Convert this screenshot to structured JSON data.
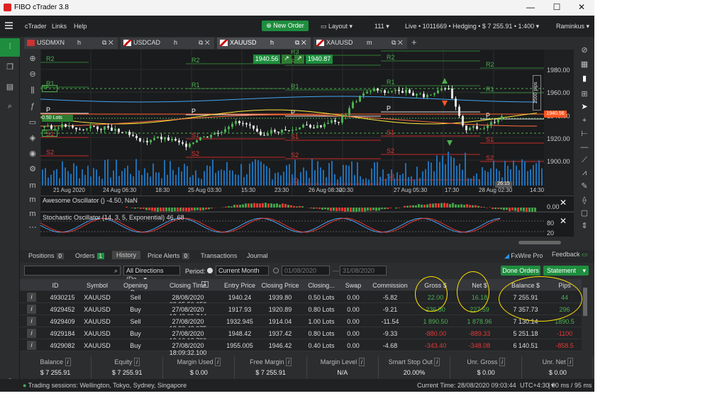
{
  "app": {
    "title": "FIBO cTrader 3.8",
    "icon": "ctrader-logo-icon"
  },
  "menu": {
    "items": [
      "cTrader",
      "Links",
      "Help"
    ],
    "new_order": "New Order",
    "layout": "Layout",
    "count": "111",
    "account": "Live • 1011669 • Hedging • $ 7 255.91 • 1:400",
    "user": "Raminkus"
  },
  "tabs": [
    {
      "symbol": "USDMXN",
      "tf": "h"
    },
    {
      "symbol": "USDCAD",
      "tf": "h"
    },
    {
      "symbol": "XAUUSD",
      "tf": "h"
    },
    {
      "symbol": "XAUUSD",
      "tf": "m"
    }
  ],
  "chart": {
    "sell_price": "1940.56",
    "buy_price": "1940.87",
    "pips_label": "2500 pips",
    "current_price": "1940.56",
    "y_ticks": [
      "1980.00",
      "1960.00",
      "1940.00",
      "1920.00",
      "1900.00"
    ],
    "x_ticks": [
      "21 Aug 2020",
      "24 Aug 06:30",
      "18:30",
      "25 Aug 03:30",
      "15:30",
      "23:30",
      "26 Aug 08:30",
      "20:30",
      "27 Aug 05:30",
      "17:30",
      "28 Aug 02:30",
      "14:30"
    ],
    "time_badge": "26:15",
    "levels": [
      "R3",
      "R2",
      "R1",
      "P",
      "S1",
      "S2",
      "S3"
    ],
    "tp_label": "TP",
    "lots_label": "0.50 Lots",
    "sl_label": "SL"
  },
  "oscillators": {
    "ao": "Awesome Oscillator () -4.50, NaN",
    "ao_tick": "0.00",
    "stoch": "Stochastic Oscillator (14, 3, 5, Exponential) 46, 68",
    "stoch_ticks": [
      "80",
      "20"
    ]
  },
  "bottom_tabs": {
    "positions": "Positions",
    "positions_count": "0",
    "orders": "Orders",
    "orders_count": "1",
    "history": "History",
    "alerts": "Price Alerts",
    "alerts_count": "0",
    "transactions": "Transactions",
    "journal": "Journal",
    "fxwire": "FxWire Pro",
    "feedback": "Feedback"
  },
  "filter": {
    "direction": "All Directions (De...",
    "period_label": "Period:",
    "period": "Current Month",
    "from": "01/08/2020",
    "to": "31/08/2020",
    "done_orders": "Done Orders",
    "statement": "Statement"
  },
  "table": {
    "headers": [
      "ID",
      "Symbol",
      "Opening D...",
      "Closing Time",
      "Entry Price",
      "Closing Price",
      "Closing...",
      "Swap",
      "Commission",
      "Gross $",
      "Net $",
      "Balance $",
      "Pips"
    ],
    "sort_badge": "1",
    "rows": [
      [
        "4930215",
        "XAUUSD",
        "Sell",
        "28/08/2020 08:35:50.653",
        "1940.24",
        "1939.80",
        "0.50 Lots",
        "0.00",
        "-5.82",
        "22.00",
        "16.18",
        "7 255.91",
        "44"
      ],
      [
        "4929452",
        "XAUUSD",
        "Buy",
        "27/08/2020 18:43:09.744",
        "1917.93",
        "1920.89",
        "0.80 Lots",
        "0.00",
        "-9.21",
        "236.80",
        "227.59",
        "7 357.73",
        "296"
      ],
      [
        "4929409",
        "XAUUSD",
        "Sell",
        "27/08/2020 18:38:48.975",
        "1932.945",
        "1914.04",
        "1.00 Lots",
        "0.00",
        "-11.54",
        "1 890.50",
        "1 878.96",
        "7 130.14",
        "1890.5"
      ],
      [
        "4929184",
        "XAUUSD",
        "Buy",
        "27/08/2020 18:16:18.799",
        "1948.42",
        "1937.42",
        "0.80 Lots",
        "0.00",
        "-9.33",
        "-880.00",
        "-889.33",
        "5 251.18",
        "-1100"
      ],
      [
        "4929082",
        "XAUUSD",
        "Buy",
        "27/08/2020 18:09:32.100",
        "1955.005",
        "1946.42",
        "0.40 Lots",
        "0.00",
        "-4.68",
        "-343.40",
        "-348.08",
        "6 140.51",
        "-858.5"
      ]
    ]
  },
  "summary": [
    {
      "label": "Balance",
      "value": "$ 7 255.91"
    },
    {
      "label": "Equity",
      "value": "$ 7 255.91"
    },
    {
      "label": "Margin Used",
      "value": "$ 0.00"
    },
    {
      "label": "Free Margin",
      "value": "$ 7 255.91"
    },
    {
      "label": "Margin Level",
      "value": "N/A"
    },
    {
      "label": "Smart Stop Out",
      "value": "20.00%"
    },
    {
      "label": "Unr. Gross",
      "value": "$ 0.00"
    },
    {
      "label": "Unr. Net",
      "value": "$ 0.00"
    }
  ],
  "status": {
    "sessions": "Trading sessions: Wellington, Tokyo, Sydney, Singapore",
    "time": "Current Time: 28/08/2020 09:03:44",
    "tz": "UTC+4:30",
    "latency": "90 ms / 95 ms"
  },
  "colors": {
    "up": "#4caf50",
    "down": "#e53935",
    "accent": "#1e8e3e",
    "annotation": "#ffe000"
  }
}
